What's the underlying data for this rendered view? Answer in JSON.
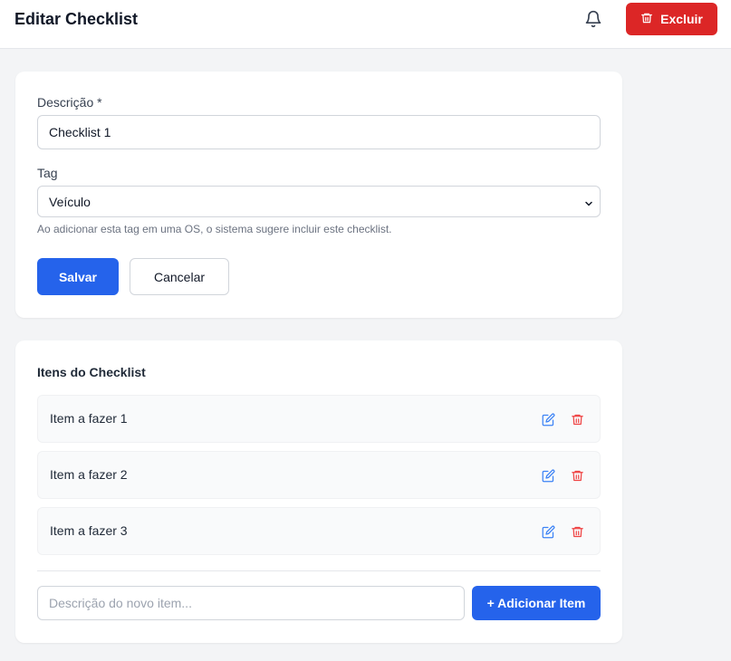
{
  "header": {
    "title": "Editar Checklist",
    "bell_icon": "bell-icon",
    "delete_label": "Excluir",
    "delete_icon": "trash-icon"
  },
  "form": {
    "description_label": "Descrição *",
    "description_value": "Checklist 1",
    "tag_label": "Tag",
    "tag_value": "Veículo",
    "tag_hint": "Ao adicionar esta tag em uma OS, o sistema sugere incluir este checklist.",
    "save_label": "Salvar",
    "cancel_label": "Cancelar"
  },
  "items_section": {
    "title": "Itens do Checklist",
    "items": [
      {
        "label": "Item a fazer 1"
      },
      {
        "label": "Item a fazer 2"
      },
      {
        "label": "Item a fazer 3"
      }
    ],
    "new_item_placeholder": "Descrição do novo item...",
    "add_label": "+ Adicionar Item"
  },
  "colors": {
    "primary": "#2563eb",
    "danger": "#dc2626",
    "edit_icon": "#3b82f6",
    "delete_icon": "#ef4444"
  }
}
